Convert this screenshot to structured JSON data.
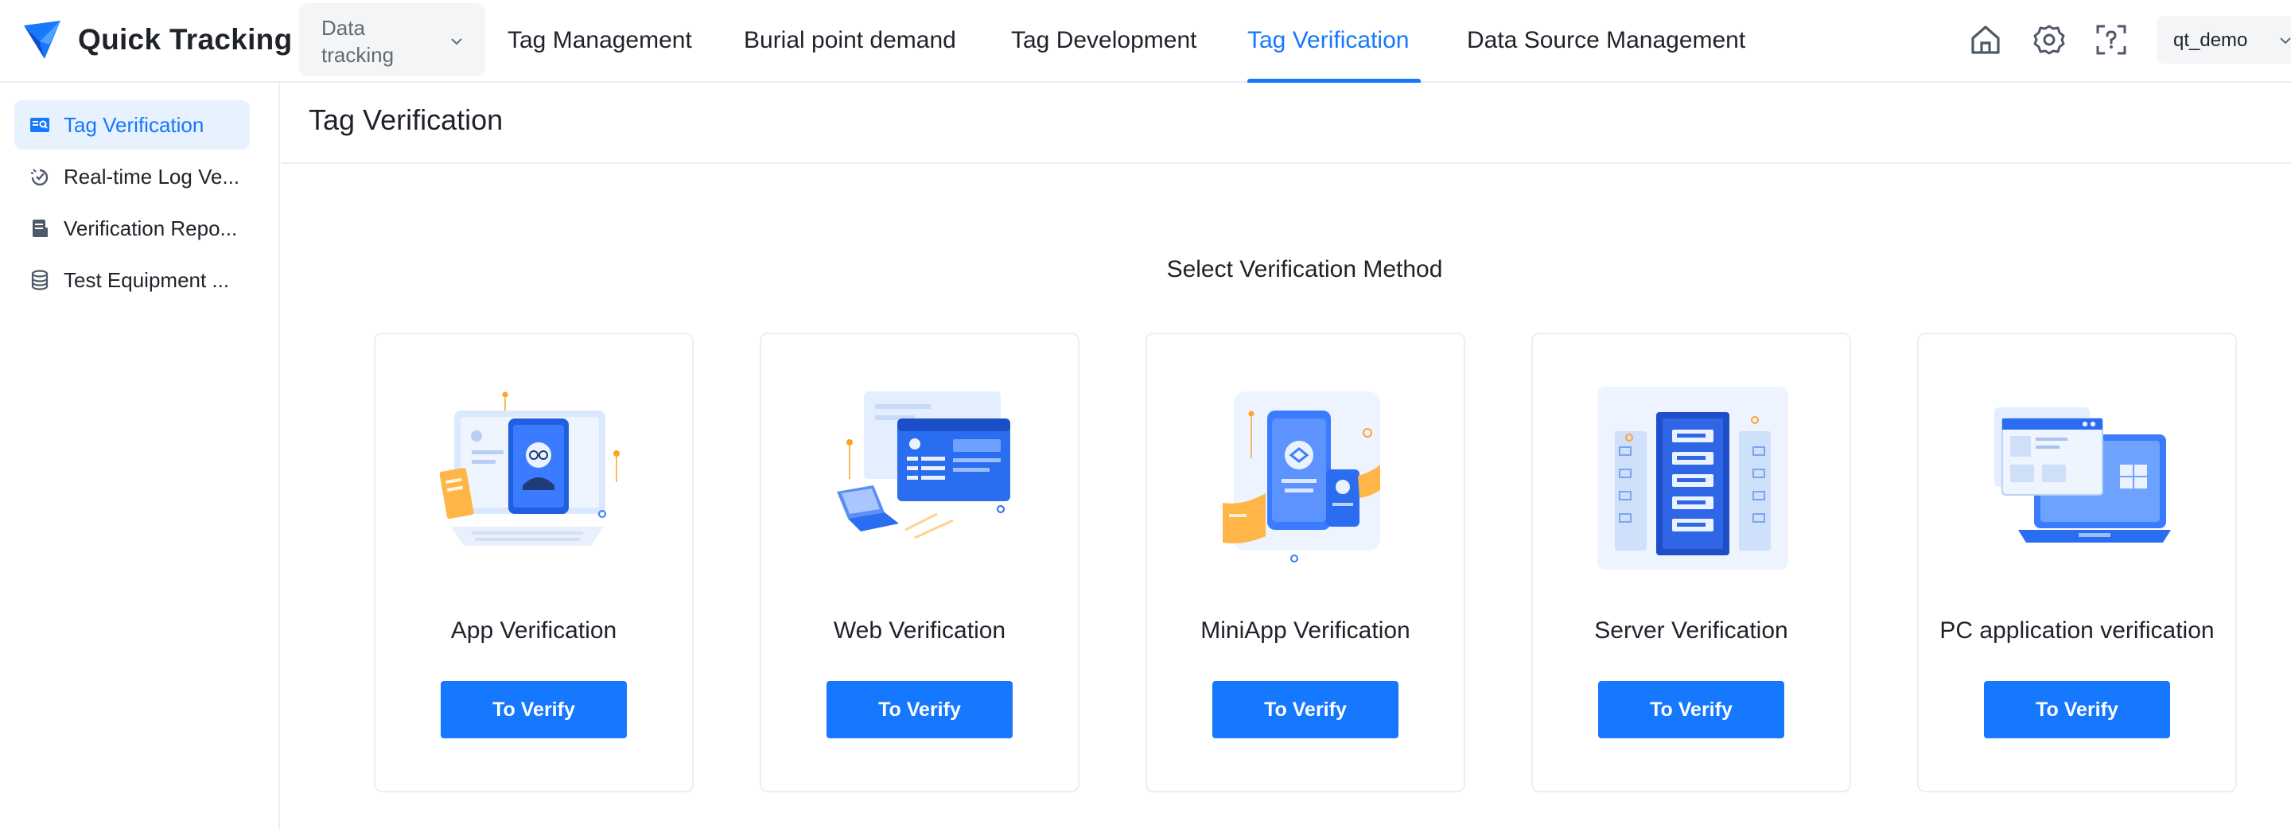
{
  "app": {
    "name": "Quick Tracking",
    "brand_color": "#1677ff"
  },
  "header": {
    "product_select": {
      "value": "Data tracking"
    },
    "tabs": [
      {
        "label": "Tag Management",
        "active": false
      },
      {
        "label": "Burial point demand",
        "active": false
      },
      {
        "label": "Tag Development",
        "active": false
      },
      {
        "label": "Tag Verification",
        "active": true
      },
      {
        "label": "Data Source Management",
        "active": false
      }
    ],
    "icons": [
      "home-icon",
      "settings-icon",
      "help-scan-icon"
    ],
    "user": {
      "name": "qt_demo"
    }
  },
  "sidebar": {
    "items": [
      {
        "label": "Tag Verification",
        "icon": "tag-verification-icon",
        "active": true
      },
      {
        "label": "Real-time Log Ve...",
        "icon": "realtime-log-icon",
        "active": false
      },
      {
        "label": "Verification Repo...",
        "icon": "report-icon",
        "active": false
      },
      {
        "label": "Test Equipment ...",
        "icon": "database-icon",
        "active": false
      }
    ]
  },
  "main": {
    "page_title": "Tag Verification",
    "section_title": "Select Verification Method",
    "cards": [
      {
        "title": "App Verification",
        "button": "To Verify",
        "illustration": "app-illustration"
      },
      {
        "title": "Web Verification",
        "button": "To Verify",
        "illustration": "web-illustration"
      },
      {
        "title": "MiniApp Verification",
        "button": "To Verify",
        "illustration": "miniapp-illustration"
      },
      {
        "title": "Server Verification",
        "button": "To Verify",
        "illustration": "server-illustration"
      },
      {
        "title": "PC application verification",
        "button": "To Verify",
        "illustration": "pc-illustration"
      }
    ]
  }
}
